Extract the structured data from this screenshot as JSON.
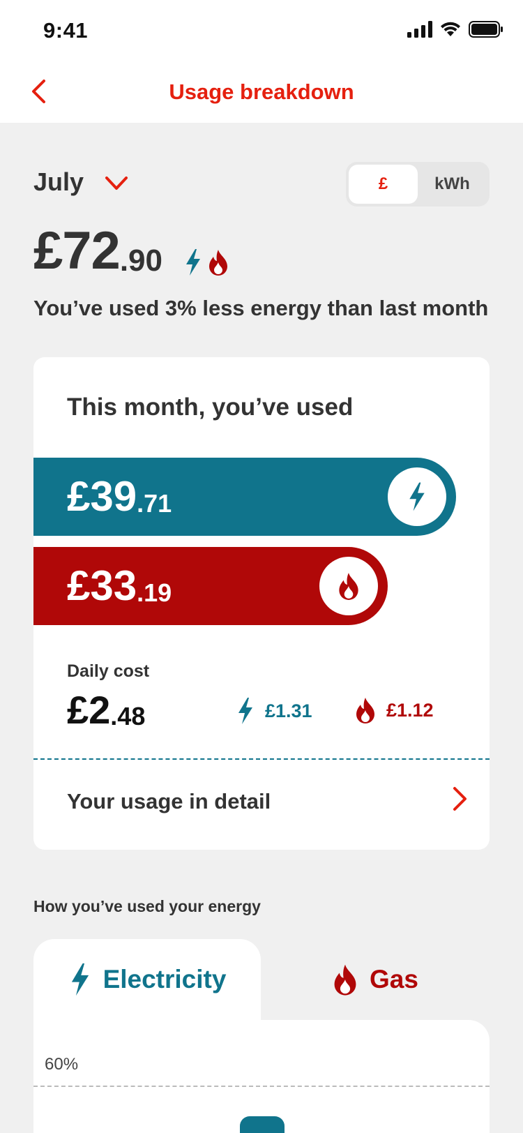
{
  "status_bar": {
    "time": "9:41"
  },
  "nav": {
    "title": "Usage breakdown"
  },
  "month": {
    "label": "July"
  },
  "unit_toggle": {
    "options": [
      "£",
      "kWh"
    ],
    "selected": "£"
  },
  "total": {
    "main": "£72",
    "decimal": ".90",
    "comparison": "You’ve used 3% less energy than last month"
  },
  "usage_card": {
    "heading": "This month, you’ve used",
    "electricity": {
      "main": "£39",
      "decimal": ".71",
      "share_of_total": 0.545
    },
    "gas": {
      "main": "£33",
      "decimal": ".19",
      "share_of_total": 0.455
    },
    "daily": {
      "label": "Daily cost",
      "main": "£2",
      "decimal": ".48",
      "electricity": "£1.31",
      "gas": "£1.12"
    },
    "detail_link": "Your usage in detail"
  },
  "energy_section": {
    "title": "How you’ve used your energy",
    "tabs": [
      {
        "label": "Electricity",
        "icon": "lightning-icon",
        "active": true
      },
      {
        "label": "Gas",
        "icon": "flame-icon",
        "active": false
      }
    ],
    "chart": {
      "y_label": "60%"
    }
  },
  "colors": {
    "accent": "#e5200f",
    "electricity": "#10748c",
    "gas": "#b00808",
    "background": "#f0f0f0"
  }
}
